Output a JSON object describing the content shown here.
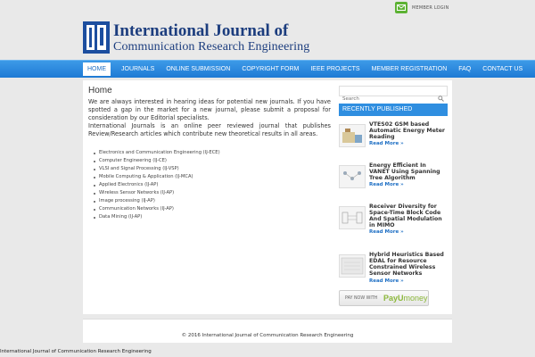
{
  "header": {
    "member_login": "MEMBER LOGIN",
    "logo_title": "International Journal of",
    "logo_subtitle": "Communication Research Engineering"
  },
  "nav": {
    "items": [
      {
        "label": "Home"
      },
      {
        "label": "Journals"
      },
      {
        "label": "Online Submission"
      },
      {
        "label": "Copyright Form"
      },
      {
        "label": "IEEE Projects"
      },
      {
        "label": "Member Registration"
      },
      {
        "label": "FAQ"
      },
      {
        "label": "Contact Us"
      }
    ]
  },
  "content": {
    "title": "Home",
    "intro_1": "We are always interested in hearing ideas for potential new journals. If you have spotted a gap in the market for a new journal, please submit a proposal for consideration by our Editorial specialists.",
    "intro_2": "International Journals is an online peer reviewed journal that publishes Review/Research articles which contribute new theoretical results in all areas.",
    "journals": [
      "Electronics and Communication Engineering (IJ-ECE)",
      "Computer Engineering (IJ-CE)",
      "VLSI and Signal Processing (IJ-VSP)",
      "Mobile Computing & Application (IJ-MCA)",
      "Applied Electronics (IJ-AP)",
      "Wireless Sensor Networks (IJ-AP)",
      "Image processing (IJ-AP)",
      "Communication Networks (IJ-AP)",
      "Data Mining (IJ-AP)"
    ]
  },
  "sidebar": {
    "search_placeholder": "Search",
    "recent_title": "RECENTLY PUBLISHED",
    "read_more": "Read More »",
    "posts": [
      {
        "title": "VTES02 GSM based Automatic Energy Meter Reading"
      },
      {
        "title": "Energy Efficient In VANET Using Spanning Tree Algorithm"
      },
      {
        "title": "Receiver Diversity for Space-Time Block Code And Spatial Modulation in MIMO"
      },
      {
        "title": "Hybrid Heuristics Based EDAL for Resource Constrained Wireless Sensor Networks"
      }
    ],
    "pay_now": "PAY NOW WITH",
    "payu_brand_a": "PayU",
    "payu_brand_b": "money"
  },
  "footer": {
    "copyright": "© 2016 International Journal of Communication Research Engineering"
  },
  "page_bottom": "International Journal of Communication Research Engineering",
  "colors": {
    "nav_blue": "#2f8ee0",
    "logo_blue": "#1c3d7e",
    "link_blue": "#1e6fc4",
    "mail_green": "#5cb233"
  }
}
